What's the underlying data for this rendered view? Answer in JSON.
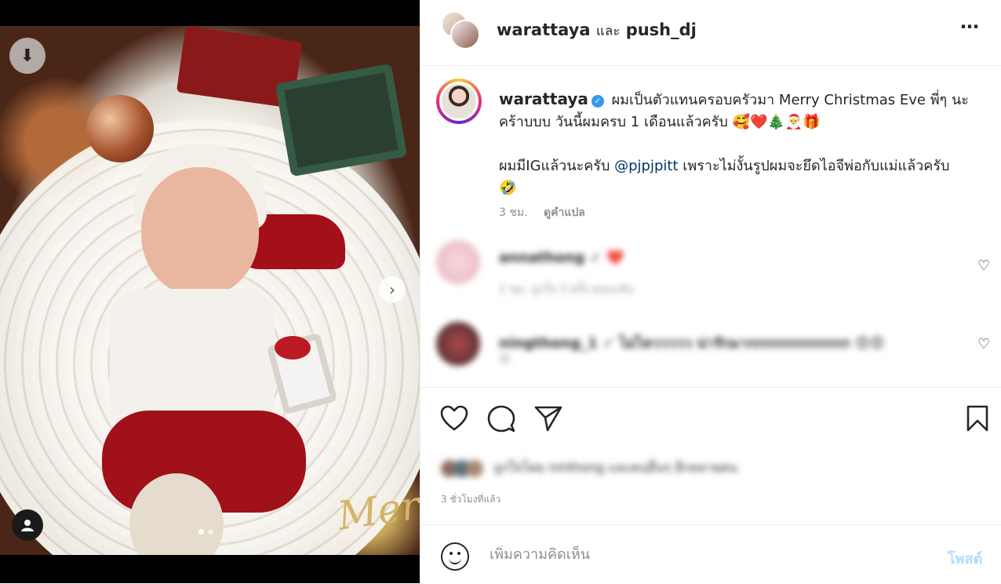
{
  "header": {
    "user_primary": "warattaya",
    "and_text": "และ",
    "user_secondary": "push_dj",
    "more_icon": "⋯"
  },
  "caption": {
    "username": "warattaya",
    "verified_icon": "check",
    "text_line1": "ผมเป็นตัวแทนครอบครัวมา Merry Christmas Eve พี่ๆ นะคร้าบบบ วันนี้ผมครบ 1 เดือนแล้วครับ 🥰❤️🎄🎅🎁",
    "text_line2_a": "ผมมีIGแล้วนะครับ ",
    "mention": "@pjpjpitt",
    "text_line2_b": " เพราะไม่งั้นรูปผมจะยึดไอจีพ่อกับแม่แล้วครับ 🤣",
    "time": "3 ชม.",
    "translate": "ดูคำแปล"
  },
  "comments": [
    {
      "line": "annathong ✓ ❤️",
      "sub": "1 ชม.    ถูกใจ 3 ครั้ง    ตอบกลับ",
      "heart": "♡"
    },
    {
      "line": "ningthong_1 ✓ ไม่ไหววววว น่ารักมากกกกกกกกกกกก 😍😍",
      "sub": "😍",
      "heart": "♡"
    }
  ],
  "actions": {
    "like_icon": "heart-icon",
    "comment_icon": "comment-icon",
    "share_icon": "send-icon",
    "save_icon": "bookmark-icon",
    "likes_text": "ถูกใจโดย ninthong และคนอื่นๆ อีกหลายคน",
    "timestamp": "3 ชั่วโมงที่แล้ว"
  },
  "compose": {
    "placeholder": "เพิ่มความคิดเห็น",
    "post_label": "โพสต์"
  },
  "media": {
    "overlay_text": "Merry",
    "dots_total": 2,
    "active_dot": 1
  }
}
